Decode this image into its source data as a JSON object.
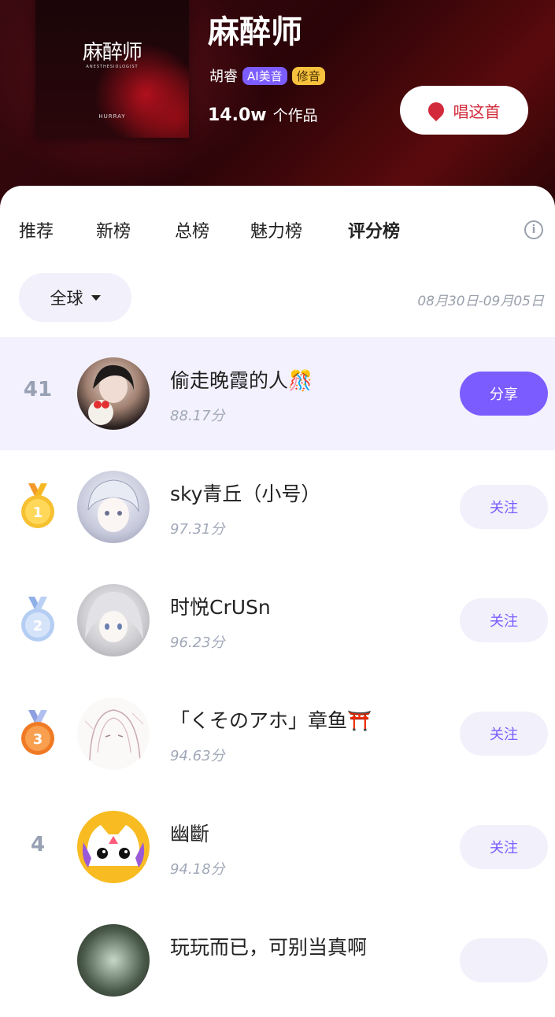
{
  "song": {
    "cover_title": "麻醉师",
    "cover_subtitle": "ANESTHESIOLOGIST",
    "cover_artist": "HURRAY",
    "title": "麻醉师",
    "artist": "胡睿",
    "tag_ai": "AI美音",
    "tag_fix": "修音",
    "works_count": "14.0w",
    "works_label": "个作品",
    "sing_button": "唱这首"
  },
  "tabs": [
    {
      "label": "推荐"
    },
    {
      "label": "新榜"
    },
    {
      "label": "总榜"
    },
    {
      "label": "魅力榜"
    },
    {
      "label": "评分榜",
      "active": true
    }
  ],
  "info_icon": "info-icon",
  "filter": {
    "region": "全球",
    "date_range": "08月30日-09月05日"
  },
  "my_entry": {
    "rank": "41",
    "name": "偷走晚霞的人🎊",
    "score": "88.17分",
    "action": "分享"
  },
  "ranking": [
    {
      "rank": "1",
      "medal": "gold",
      "name": "sky青丘（小号）",
      "score": "97.31分",
      "action": "关注"
    },
    {
      "rank": "2",
      "medal": "silver",
      "name": "时悦CrUSn",
      "score": "96.23分",
      "action": "关注"
    },
    {
      "rank": "3",
      "medal": "bronze",
      "name": "「くそのアホ」章鱼⛩️",
      "score": "94.63分",
      "action": "关注"
    },
    {
      "rank": "4",
      "medal": "",
      "name": "幽斷",
      "score": "94.18分",
      "action": "关注"
    },
    {
      "rank": "",
      "medal": "",
      "name": "玩玩而已，可别当真啊",
      "score": "",
      "action": ""
    }
  ],
  "colors": {
    "accent": "#7b5cff",
    "gold": "#f6b820",
    "silver": "#a9c4ee",
    "bronze": "#f0802a",
    "sing_red": "#d22a3a"
  }
}
